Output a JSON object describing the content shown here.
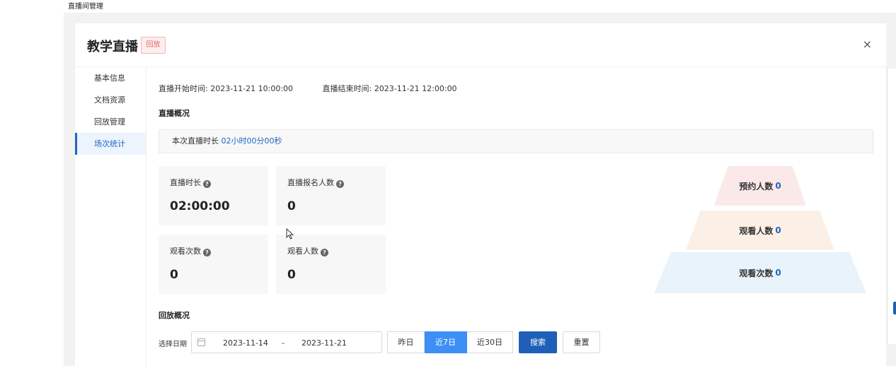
{
  "topbar": {
    "title": "直播间管理"
  },
  "modal": {
    "title": "教学直播",
    "status_tag": "回放",
    "close_label": "×"
  },
  "sidebar": {
    "items": [
      {
        "label": "基本信息",
        "active": false
      },
      {
        "label": "文档资源",
        "active": false
      },
      {
        "label": "回放管理",
        "active": false
      },
      {
        "label": "场次统计",
        "active": true
      }
    ]
  },
  "times": {
    "start": "直播开始时间: 2023-11-21 10:00:00",
    "end": "直播结束时间: 2023-11-21 12:00:00"
  },
  "live_overview": {
    "title": "直播概况",
    "duration_prefix": "本次直播时长",
    "duration_value": "02小时00分00秒"
  },
  "stats": [
    {
      "label": "直播时长",
      "value": "02:00:00"
    },
    {
      "label": "直播报名人数",
      "value": "0"
    },
    {
      "label": "观看次数",
      "value": "0"
    },
    {
      "label": "观看人数",
      "value": "0"
    }
  ],
  "funnel": [
    {
      "label": "预约人数",
      "value": "0",
      "color": "#fbe9ea"
    },
    {
      "label": "观看人数",
      "value": "0",
      "color": "#fcf0e6"
    },
    {
      "label": "观看次数",
      "value": "0",
      "color": "#e8f3fc"
    }
  ],
  "replay_overview": {
    "title": "回放概况",
    "date_label": "选择日期",
    "date_start": "2023-11-14",
    "date_sep": "-",
    "date_end": "2023-11-21",
    "ranges": [
      {
        "label": "昨日",
        "active": false
      },
      {
        "label": "近7日",
        "active": true
      },
      {
        "label": "近30日",
        "active": false
      }
    ],
    "search_label": "搜索",
    "reset_label": "重置"
  },
  "colors": {
    "accent": "#1f66c0",
    "primary_button": "#1f5fb8",
    "segment_active": "#3d8ff5",
    "tag_red": "#e06666"
  }
}
